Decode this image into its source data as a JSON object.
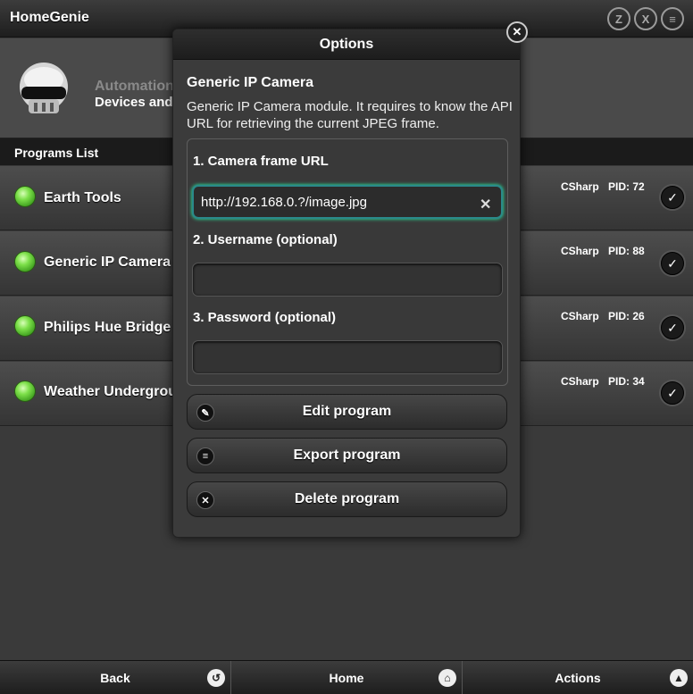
{
  "app": {
    "title": "HomeGenie"
  },
  "header_icons": [
    {
      "name": "zwave-icon",
      "glyph": "Z"
    },
    {
      "name": "x10-icon",
      "glyph": "X"
    },
    {
      "name": "filter-icon",
      "glyph": "≡"
    }
  ],
  "banner": {
    "line1": "Automation",
    "line2": "Devices and"
  },
  "list": {
    "header": "Programs List",
    "programs": [
      {
        "name": "Earth Tools",
        "lang": "CSharp",
        "pid": "PID: 72"
      },
      {
        "name": "Generic IP Camera",
        "lang": "CSharp",
        "pid": "PID: 88"
      },
      {
        "name": "Philips Hue Bridge",
        "lang": "CSharp",
        "pid": "PID: 26"
      },
      {
        "name": "Weather Undergrou",
        "lang": "CSharp",
        "pid": "PID: 34"
      }
    ]
  },
  "dialog": {
    "title": "Options",
    "module_name": "Generic IP Camera",
    "description": "Generic IP Camera module. It requires to know the API URL for retrieving the current JPEG frame.",
    "fields": [
      {
        "label": "1. Camera frame URL",
        "value": "http://192.168.0.?/image.jpg",
        "placeholder": ""
      },
      {
        "label": "2. Username (optional)",
        "value": "",
        "placeholder": ""
      },
      {
        "label": "3. Password (optional)",
        "value": "",
        "placeholder": ""
      }
    ],
    "buttons": [
      {
        "label": "Edit program",
        "icon": "pencil-icon",
        "glyph": "✎"
      },
      {
        "label": "Export program",
        "icon": "list-icon",
        "glyph": "≡"
      },
      {
        "label": "Delete program",
        "icon": "delete-icon",
        "glyph": "✕"
      }
    ]
  },
  "footer": {
    "tabs": [
      {
        "label": "Back",
        "icon": "back-icon",
        "glyph": "↺"
      },
      {
        "label": "Home",
        "icon": "home-icon",
        "glyph": "⌂"
      },
      {
        "label": "Actions",
        "icon": "chevron-up-icon",
        "glyph": "▲"
      }
    ]
  }
}
